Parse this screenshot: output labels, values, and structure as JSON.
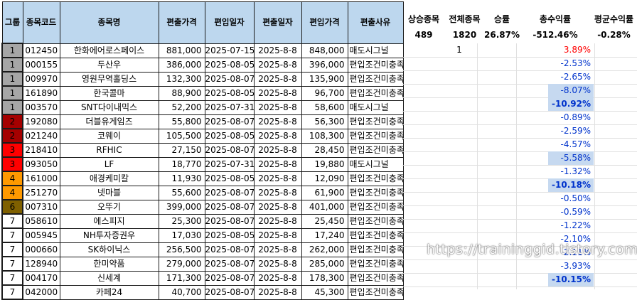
{
  "headers": [
    "그룹",
    "종목코드",
    "종목명",
    "편출가격",
    "편입일자",
    "편출일자",
    "편입가격",
    "편출사유"
  ],
  "summary": {
    "labels": [
      "상승종목",
      "전체종목",
      "승률",
      "총수익률",
      "평균수익률"
    ],
    "values": [
      "489",
      "1820",
      "26.87%",
      "-512.46%",
      "-0.28%"
    ]
  },
  "rows": [
    {
      "group": "1",
      "code": "012450",
      "name": "한화에어로스페이스",
      "out_price": "881,000",
      "in_date": "2025-07-15",
      "out_date": "2025-8-8",
      "in_price": "848,000",
      "reason": "매도시그널",
      "rise": "1",
      "ret": "3.89%"
    },
    {
      "group": "1",
      "code": "000155",
      "name": "두산우",
      "out_price": "386,000",
      "in_date": "2025-08-05",
      "out_date": "2025-8-8",
      "in_price": "396,000",
      "reason": "편입조건미충족",
      "rise": "",
      "ret": "-2.53%"
    },
    {
      "group": "1",
      "code": "009970",
      "name": "영원무역홀딩스",
      "out_price": "132,300",
      "in_date": "2025-08-07",
      "out_date": "2025-8-8",
      "in_price": "135,900",
      "reason": "편입조건미충족",
      "rise": "",
      "ret": "-2.65%"
    },
    {
      "group": "1",
      "code": "161890",
      "name": "한국콜마",
      "out_price": "88,900",
      "in_date": "2025-08-05",
      "out_date": "2025-8-8",
      "in_price": "96,700",
      "reason": "편입조건미충족",
      "rise": "",
      "ret": "-8.07%"
    },
    {
      "group": "1",
      "code": "003570",
      "name": "SNT다이내믹스",
      "out_price": "52,200",
      "in_date": "2025-07-31",
      "out_date": "2025-8-8",
      "in_price": "58,600",
      "reason": "매도시그널",
      "rise": "",
      "ret": "-10.92%"
    },
    {
      "group": "2",
      "code": "192080",
      "name": "더블유게임즈",
      "out_price": "55,800",
      "in_date": "2025-08-07",
      "out_date": "2025-8-8",
      "in_price": "56,300",
      "reason": "편입조건미충족",
      "rise": "",
      "ret": "-0.89%"
    },
    {
      "group": "2",
      "code": "021240",
      "name": "코웨이",
      "out_price": "105,500",
      "in_date": "2025-08-05",
      "out_date": "2025-8-8",
      "in_price": "108,300",
      "reason": "편입조건미충족",
      "rise": "",
      "ret": "-2.59%"
    },
    {
      "group": "3",
      "code": "218410",
      "name": "RFHIC",
      "out_price": "27,150",
      "in_date": "2025-08-07",
      "out_date": "2025-8-8",
      "in_price": "28,450",
      "reason": "편입조건미충족",
      "rise": "",
      "ret": "-4.57%"
    },
    {
      "group": "3",
      "code": "093050",
      "name": "LF",
      "out_price": "18,770",
      "in_date": "2025-07-31",
      "out_date": "2025-8-8",
      "in_price": "19,880",
      "reason": "매도시그널",
      "rise": "",
      "ret": "-5.58%"
    },
    {
      "group": "4",
      "code": "161000",
      "name": "애경케미칼",
      "out_price": "11,930",
      "in_date": "2025-08-05",
      "out_date": "2025-8-8",
      "in_price": "12,090",
      "reason": "편입조건미충족",
      "rise": "",
      "ret": "-1.32%"
    },
    {
      "group": "4",
      "code": "251270",
      "name": "넷마블",
      "out_price": "55,600",
      "in_date": "2025-08-07",
      "out_date": "2025-8-8",
      "in_price": "61,900",
      "reason": "편입조건미충족",
      "rise": "",
      "ret": "-10.18%"
    },
    {
      "group": "6",
      "code": "007310",
      "name": "오뚜기",
      "out_price": "399,000",
      "in_date": "2025-08-07",
      "out_date": "2025-8-8",
      "in_price": "401,000",
      "reason": "편입조건미충족",
      "rise": "",
      "ret": "-0.50%"
    },
    {
      "group": "7",
      "code": "058610",
      "name": "에스피지",
      "out_price": "25,300",
      "in_date": "2025-08-07",
      "out_date": "2025-8-8",
      "in_price": "25,450",
      "reason": "편입조건미충족",
      "rise": "",
      "ret": "-0.59%"
    },
    {
      "group": "7",
      "code": "005945",
      "name": "NH투자증권우",
      "out_price": "17,030",
      "in_date": "2025-08-05",
      "out_date": "2025-8-8",
      "in_price": "17,240",
      "reason": "편입조건미충족",
      "rise": "",
      "ret": "-1.22%"
    },
    {
      "group": "7",
      "code": "000660",
      "name": "SK하이닉스",
      "out_price": "256,500",
      "in_date": "2025-08-07",
      "out_date": "2025-8-8",
      "in_price": "262,000",
      "reason": "편입조건미충족",
      "rise": "",
      "ret": "-2.10%"
    },
    {
      "group": "7",
      "code": "128940",
      "name": "한미약품",
      "out_price": "279,000",
      "in_date": "2025-08-07",
      "out_date": "2025-8-8",
      "in_price": "285,000",
      "reason": "편입조건미충족",
      "rise": "",
      "ret": "-2.11%"
    },
    {
      "group": "7",
      "code": "004170",
      "name": "신세계",
      "out_price": "171,300",
      "in_date": "2025-08-07",
      "out_date": "2025-8-8",
      "in_price": "178,300",
      "reason": "편입조건미충족",
      "rise": "",
      "ret": "-3.93%"
    },
    {
      "group": "7",
      "code": "042000",
      "name": "카페24",
      "out_price": "40,700",
      "in_date": "2025-08-07",
      "out_date": "2025-8-8",
      "in_price": "45,300",
      "reason": "편입조건미충족",
      "rise": "",
      "ret": "-10.15%"
    }
  ],
  "group_colors": {
    "1": "#a6a6a6",
    "2": "#a50000",
    "3": "#ff0000",
    "4": "#ff9900",
    "6": "#7f6000",
    "7": "#ffffff"
  },
  "colors": {
    "positive": "#ff0000",
    "negative": "#0033cc",
    "highlight": "#c6d9f0",
    "header_fill": "#bdd7ee"
  },
  "watermark": "https://traininggid.tistory.com"
}
